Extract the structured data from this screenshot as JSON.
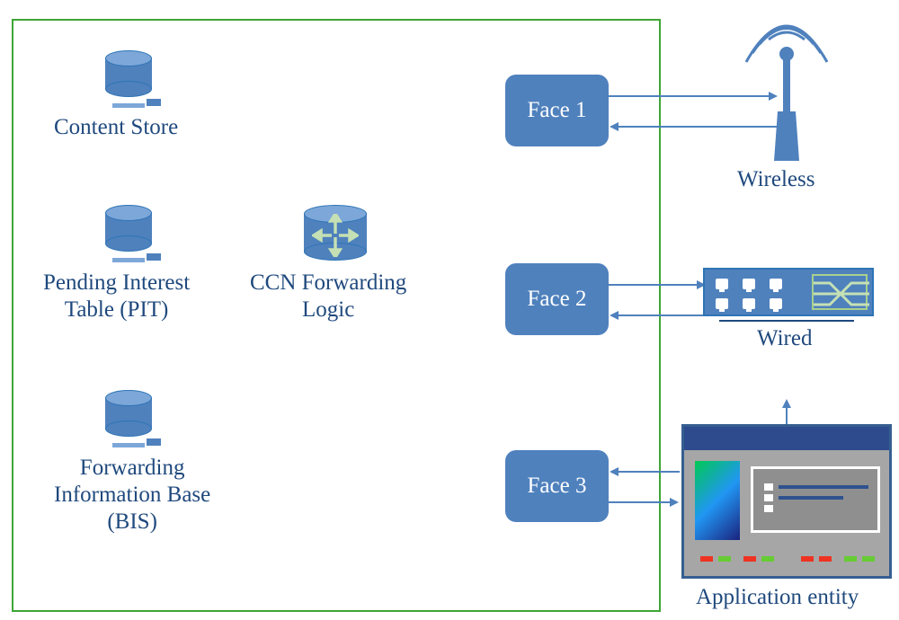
{
  "boundary": {
    "label": ""
  },
  "stores": {
    "content_store": {
      "label": "Content Store"
    },
    "pit": {
      "label": "Pending Interest\nTable (PIT)"
    },
    "fib": {
      "label": "Forwarding\nInformation Base\n(BIS)"
    }
  },
  "logic": {
    "ccn_forwarding": {
      "label": "CCN Forwarding\nLogic"
    }
  },
  "faces": [
    {
      "id": "face-1",
      "label": "Face 1"
    },
    {
      "id": "face-2",
      "label": "Face 2"
    },
    {
      "id": "face-3",
      "label": "Face 3"
    }
  ],
  "external": {
    "wireless": {
      "label": "Wireless"
    },
    "wired": {
      "label": "Wired"
    },
    "application": {
      "label": "Application entity"
    }
  },
  "icons": {
    "database": "database-icon",
    "routing_arrows": "routing-arrows-icon",
    "antenna": "wireless-antenna-icon",
    "switch": "ethernet-switch-icon",
    "app_window": "application-window-icon"
  },
  "connections": [
    {
      "from": "face-1",
      "to": "wireless",
      "bidirectional": true
    },
    {
      "from": "face-2",
      "to": "wired",
      "bidirectional": true
    },
    {
      "from": "face-3",
      "to": "application",
      "bidirectional": true
    }
  ]
}
